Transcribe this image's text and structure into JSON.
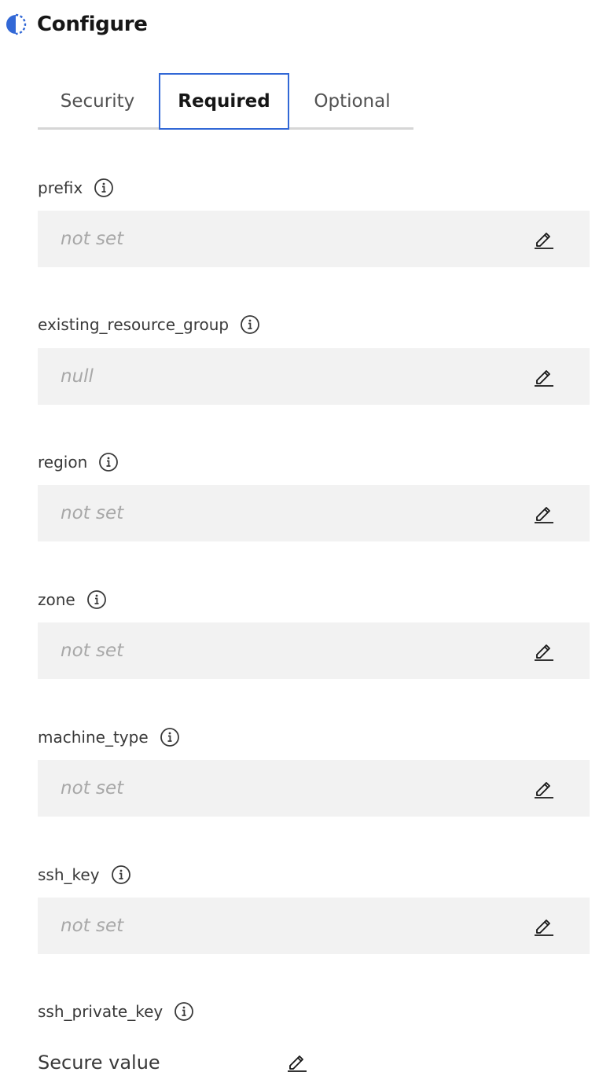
{
  "header": {
    "title": "Configure",
    "logo_icon": "half-circle-status-icon",
    "accent": "#3268d6"
  },
  "tabs": [
    {
      "label": "Security",
      "selected": false
    },
    {
      "label": "Required",
      "selected": true
    },
    {
      "label": "Optional",
      "selected": false
    }
  ],
  "fields": [
    {
      "label": "prefix",
      "value": "not set"
    },
    {
      "label": "existing_resource_group",
      "value": "null"
    },
    {
      "label": "region",
      "value": "not set"
    },
    {
      "label": "zone",
      "value": "not set"
    },
    {
      "label": "machine_type",
      "value": "not set"
    },
    {
      "label": "ssh_key",
      "value": "not set"
    },
    {
      "label": "ssh_private_key",
      "value": "Secure value"
    }
  ],
  "icons": {
    "info": "info-icon",
    "edit": "pencil-edit-icon"
  }
}
